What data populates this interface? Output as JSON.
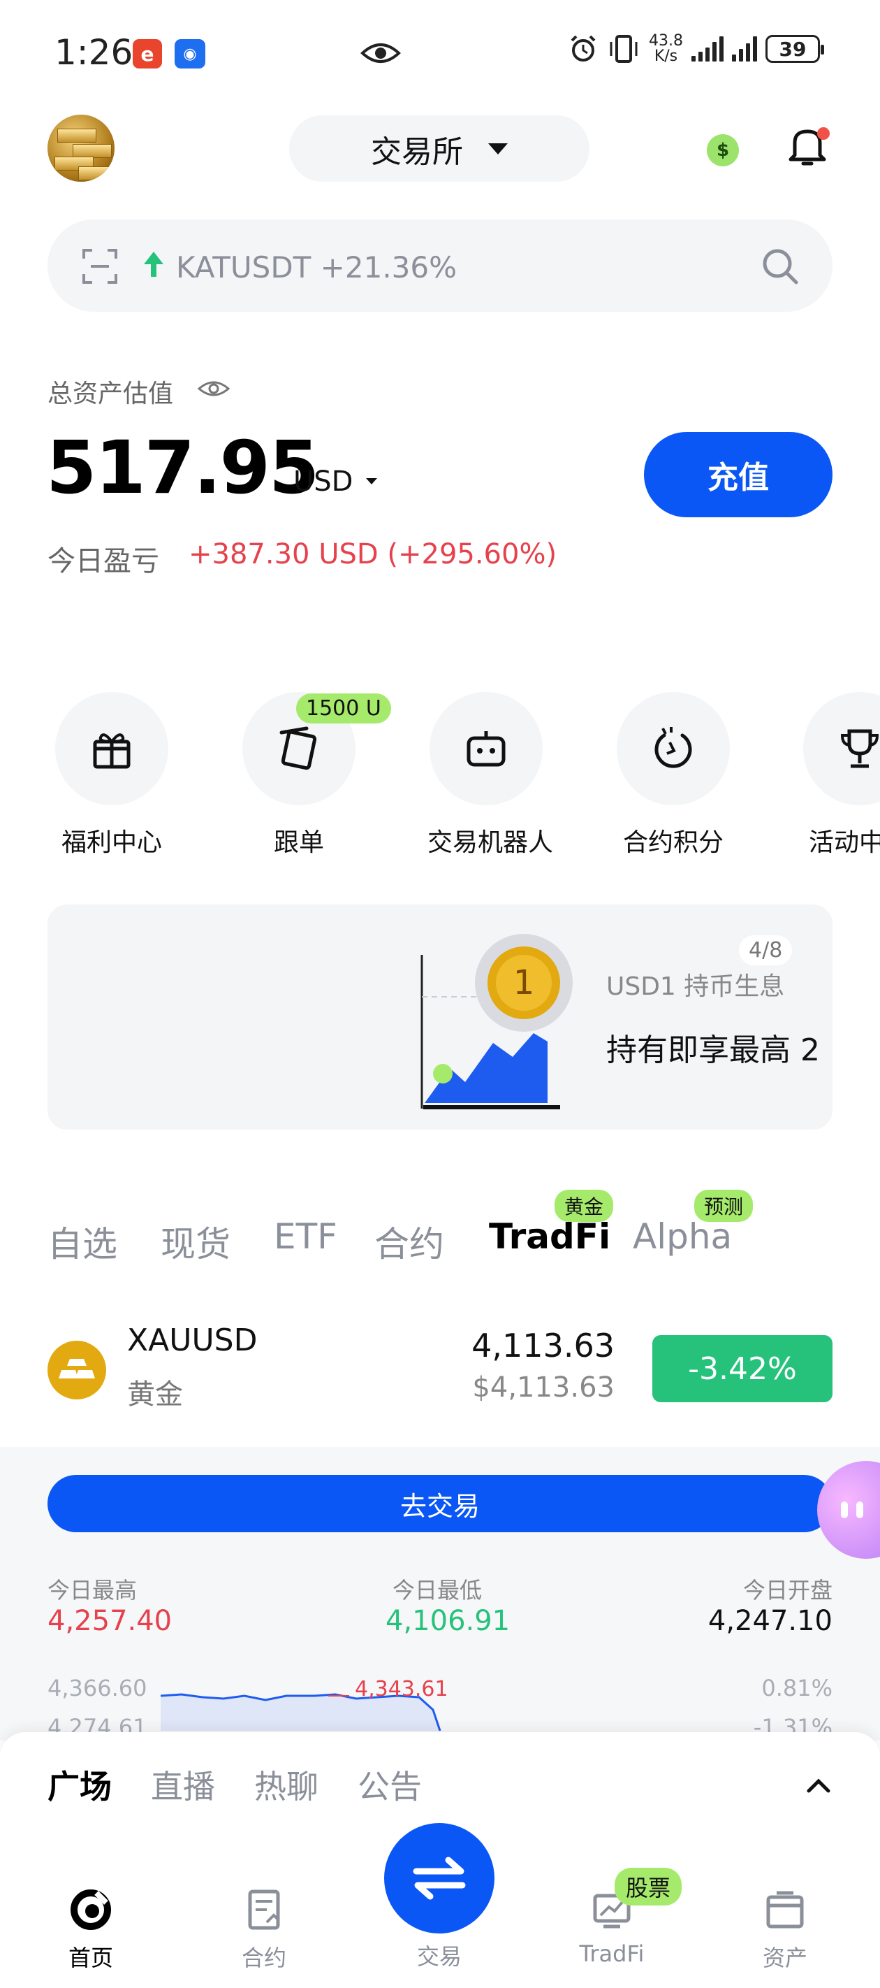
{
  "status_bar": {
    "time": "1:26",
    "net_speed": "43.8",
    "net_unit": "K/s",
    "battery": "39"
  },
  "header": {
    "exchange_label": "交易所"
  },
  "search": {
    "trend_text": "KATUSDT +21.36%"
  },
  "assets": {
    "label": "总资产估值",
    "balance": "517.95",
    "unit": "USD",
    "deposit_label": "充值",
    "pnl_label": "今日盈亏",
    "pnl_value": "+387.30 USD (+295.60%)"
  },
  "shortcuts": [
    {
      "label": "福利中心",
      "icon": "gift-icon"
    },
    {
      "label": "跟单",
      "icon": "copy-trade-icon",
      "badge": "1500 U"
    },
    {
      "label": "交易机器人",
      "icon": "robot-icon"
    },
    {
      "label": "合约积分",
      "icon": "points-icon"
    },
    {
      "label": "活动中",
      "icon": "trophy-icon"
    }
  ],
  "banner": {
    "title": "USD1 持币生息",
    "subtitle": "持有即享最高 2",
    "counter": "4/8",
    "coin_text": "1"
  },
  "tabs": [
    {
      "label": "自选"
    },
    {
      "label": "现货"
    },
    {
      "label": "ETF"
    },
    {
      "label": "合约"
    },
    {
      "label": "TradFi",
      "badge": "黄金",
      "active": true
    },
    {
      "label": "Alpha",
      "badge": "预测"
    }
  ],
  "market_row": {
    "symbol": "XAUUSD",
    "name": "黄金",
    "price": "4,113.63",
    "price_usd": "$4,113.63",
    "change": "-3.42%"
  },
  "detail": {
    "go_trade_label": "去交易",
    "today_high_label": "今日最高",
    "today_high": "4,257.40",
    "today_low_label": "今日最低",
    "today_low": "4,106.91",
    "today_open_label": "今日开盘",
    "today_open": "4,247.10",
    "axis_top": "4,366.60",
    "axis_mid": "4,274.61",
    "marker": "4,343.61",
    "pct_top": "0.81%",
    "pct_mid": "-1.31%"
  },
  "feed_tabs": [
    {
      "label": "广场",
      "active": true
    },
    {
      "label": "直播"
    },
    {
      "label": "热聊"
    },
    {
      "label": "公告"
    }
  ],
  "bottom_nav": {
    "home": "首页",
    "contract": "合约",
    "trade": "交易",
    "tradfi": "TradFi",
    "tradfi_badge": "股票",
    "assets": "资产"
  },
  "colors": {
    "primary": "#0a57f5",
    "up_green": "#26c27c",
    "down_red": "#e5424d",
    "badge_green": "#a6ea6b"
  }
}
